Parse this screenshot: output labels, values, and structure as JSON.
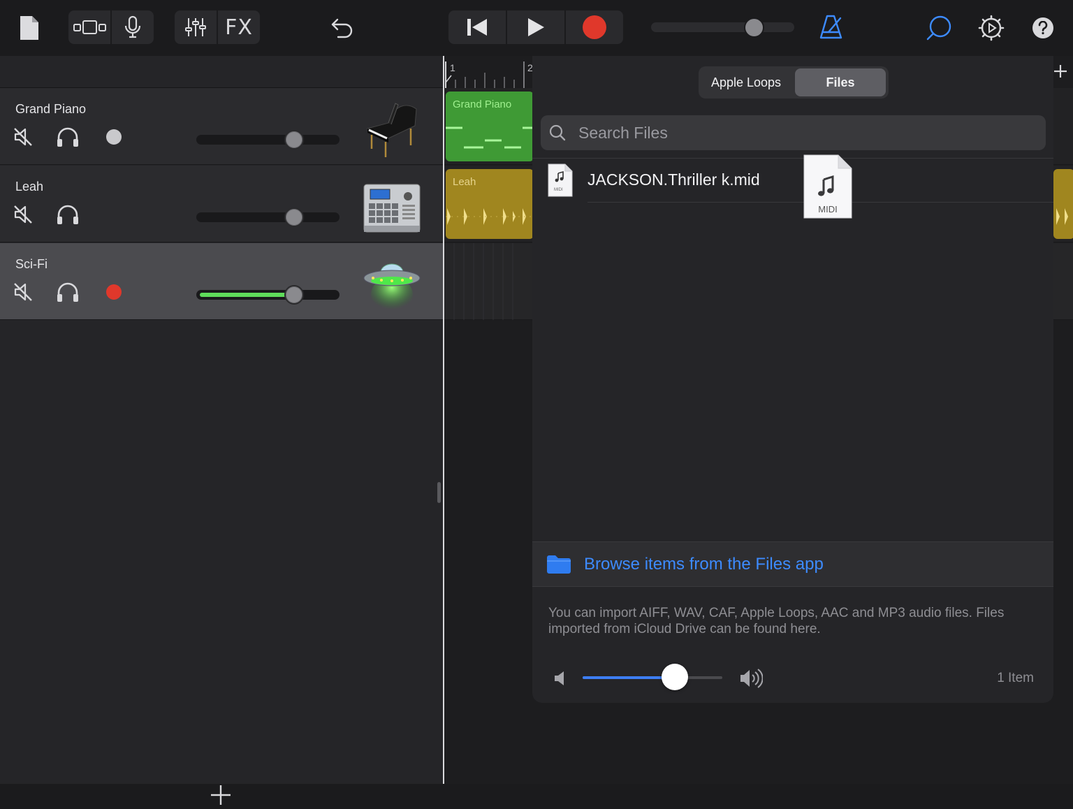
{
  "toolbar": {
    "fx_label": "FX",
    "master_volume": 0.72
  },
  "tracks": [
    {
      "name": "Grand Piano",
      "instrument_icon": "grand-piano-icon",
      "volume": 0.69,
      "record_armed": false,
      "selected": false
    },
    {
      "name": "Leah",
      "instrument_icon": "drum-machine-icon",
      "volume": 0.69,
      "record_armed": null,
      "selected": false
    },
    {
      "name": "Sci-Fi",
      "instrument_icon": "ufo-icon",
      "volume": 0.69,
      "record_armed": true,
      "selected": true
    }
  ],
  "timeline": {
    "ruler_marks": [
      "1",
      "2"
    ],
    "regions": [
      {
        "label": "Grand Piano",
        "color": "#3f9a35",
        "label_color": "#9ff08f"
      },
      {
        "label": "Leah",
        "color": "#a0861f",
        "label_color": "#e6d48c"
      }
    ],
    "add_label": "+"
  },
  "browser": {
    "tabs": [
      {
        "label": "Apple Loops",
        "active": false
      },
      {
        "label": "Files",
        "active": true
      }
    ],
    "search_placeholder": "Search Files",
    "files": [
      {
        "name": "JACKSON.Thriller k.mid",
        "icon": "midi-file-icon",
        "icon_caption": "MIDI"
      }
    ],
    "drag_ghost_caption": "MIDI",
    "browse_link": "Browse items from the Files app",
    "info": "You can import AIFF, WAV, CAF, Apple Loops, AAC and MP3 audio files. Files imported from iCloud Drive can be found here.",
    "preview_volume": 0.66,
    "item_count": "1 Item"
  },
  "colors": {
    "accent_blue": "#3d8bff",
    "record_red": "#e0382b",
    "level_green": "#5fdc5a"
  }
}
